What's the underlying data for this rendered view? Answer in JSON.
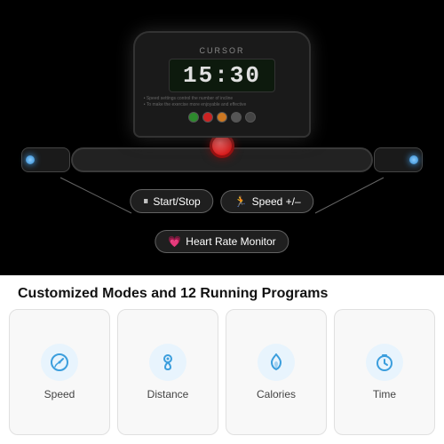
{
  "treadmill": {
    "brand": "CURSOR",
    "display_time": "15:30",
    "console_text1": "• Speed settings control the number of incline",
    "console_text2": "• To make the exercise more enjoyable and effective",
    "emergency_color": "#cc0000"
  },
  "labels": {
    "start_stop": "Start/Stop",
    "speed": "Speed +/–",
    "heart_rate": "Heart Rate Monitor"
  },
  "tagline": "Customized Modes and 12 Running Programs",
  "features": [
    {
      "name": "Speed",
      "icon": "speed"
    },
    {
      "name": "Distance",
      "icon": "distance"
    },
    {
      "name": "Calories",
      "icon": "calories"
    },
    {
      "name": "Time",
      "icon": "time"
    }
  ],
  "colors": {
    "accent_blue": "#3b9edd",
    "btn_green": "#2d8a2d",
    "btn_red": "#cc2222",
    "btn_orange": "#cc7722",
    "emergency_red": "#cc0000"
  }
}
